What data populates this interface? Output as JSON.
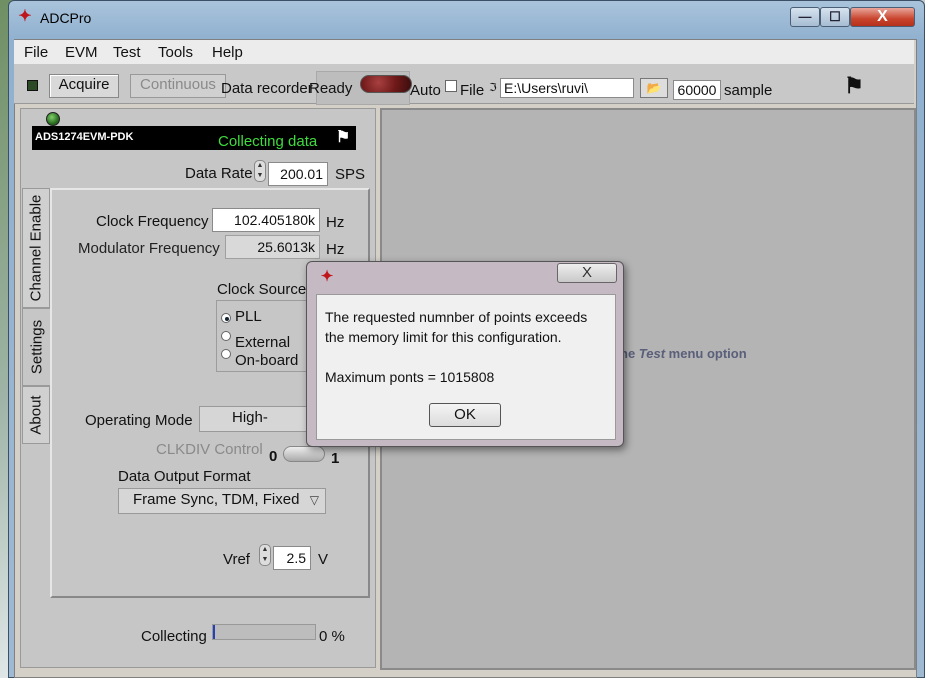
{
  "window": {
    "title": "ADCPro",
    "minimize": "—",
    "maximize": "☐",
    "close": "X"
  },
  "menu": [
    "File",
    "EVM",
    "Test",
    "Tools",
    "Help"
  ],
  "toolbar": {
    "acquire": "Acquire",
    "continuous": "Continuous",
    "data_recorder": "Data recorder",
    "ready": "Ready",
    "auto": "Auto",
    "file": "File",
    "path": "E:\\Users\\ruvi\\",
    "samples": "60000",
    "samples_label": "sample"
  },
  "evm": {
    "name": "ADS1274EVM-PDK",
    "status": "Collecting data"
  },
  "settings": {
    "data_rate_label": "Data Rate",
    "data_rate": "200.01",
    "data_rate_unit": "SPS",
    "clock_freq_label": "Clock Frequency",
    "clock_freq": "102.405180k",
    "clock_freq_unit": "Hz",
    "mod_freq_label": "Modulator Frequency",
    "mod_freq": "25.6013k",
    "mod_freq_unit": "Hz",
    "clock_source_label": "Clock Source",
    "clock_sources": [
      "PLL",
      "External",
      "On-board"
    ],
    "clock_source_selected": "PLL",
    "operating_mode_label": "Operating Mode",
    "operating_mode": "High-",
    "clkdiv_label": "CLKDIV Control",
    "clkdiv_left": "0",
    "clkdiv_right": "1",
    "data_output_label": "Data Output Format",
    "data_output": "Frame Sync, TDM, Fixed",
    "vref_label": "Vref",
    "vref": "2.5",
    "vref_unit": "V"
  },
  "tabs": [
    "Channel Enable",
    "Settings",
    "About"
  ],
  "tab_active": "Settings",
  "collecting": {
    "label": "Collecting",
    "percent_text": "0 %",
    "progress": 0.01
  },
  "right_hint": {
    "prefix": "he",
    "test": "Test",
    "suffix": "menu option"
  },
  "dialog": {
    "close": "X",
    "line1": "The requested numnber of points exceeds",
    "line2": "the memory limit for this configuration.",
    "line3": "Maximum ponts = 1015808",
    "ok": "OK"
  },
  "colors": {
    "status_green": "#3edc3e",
    "ti_red": "#c0161b",
    "progress_blue": "#2740b8"
  }
}
